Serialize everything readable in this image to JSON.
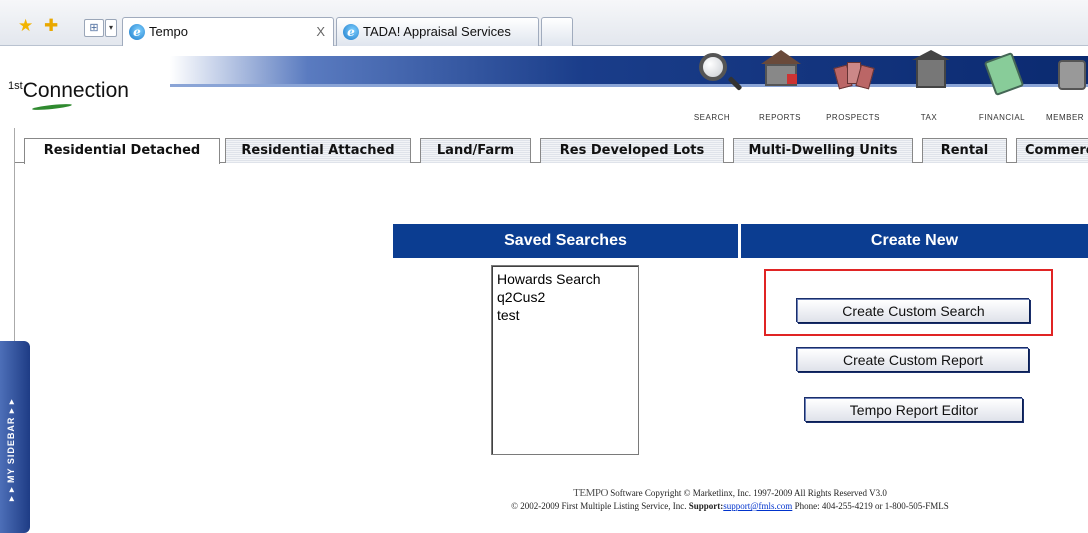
{
  "browser": {
    "tabs": [
      {
        "title": "Tempo",
        "close": "X"
      },
      {
        "title": "TADA! Appraisal Services"
      }
    ]
  },
  "app": {
    "logo_sup": "1st",
    "logo_text": "Connection",
    "nav_icons": [
      {
        "label": "SEARCH",
        "icon": "magnifier-icon"
      },
      {
        "label": "REPORTS",
        "icon": "house-report-icon"
      },
      {
        "label": "PROSPECTS",
        "icon": "prospects-icon"
      },
      {
        "label": "TAX",
        "icon": "tax-building-icon"
      },
      {
        "label": "FINANCIAL",
        "icon": "calculator-icon"
      },
      {
        "label": "MEMBER",
        "icon": "member-icon"
      }
    ]
  },
  "property_tabs": [
    "Residential Detached",
    "Residential Attached",
    "Land/Farm",
    "Res Developed Lots",
    "Multi-Dwelling Units",
    "Rental",
    "Commercial"
  ],
  "sidebar": {
    "label": "▸ ▸  MY SIDEBAR  ▸ ▸"
  },
  "saved_searches": {
    "heading": "Saved Searches",
    "items": [
      "Howards Search",
      "q2Cus2",
      "test"
    ]
  },
  "create_new": {
    "heading": "Create New",
    "buttons": [
      "Create Custom Search",
      "Create Custom Report",
      "Tempo Report Editor"
    ]
  },
  "footer": {
    "tempo_mark": "TEMPO",
    "copyright": "Software Copyright © Marketlinx, Inc. 1997-2009 All Rights Reserved V3.0",
    "line2_prefix": "© 2002-2009 First Multiple Listing Service, Inc. ",
    "support_label": "Support:",
    "support_email": "support@fmls.com",
    "phone": " Phone: 404-255-4219 or 1-800-505-FMLS"
  },
  "colors": {
    "header_blue": "#0b3d91",
    "highlight_red": "#e02424"
  }
}
